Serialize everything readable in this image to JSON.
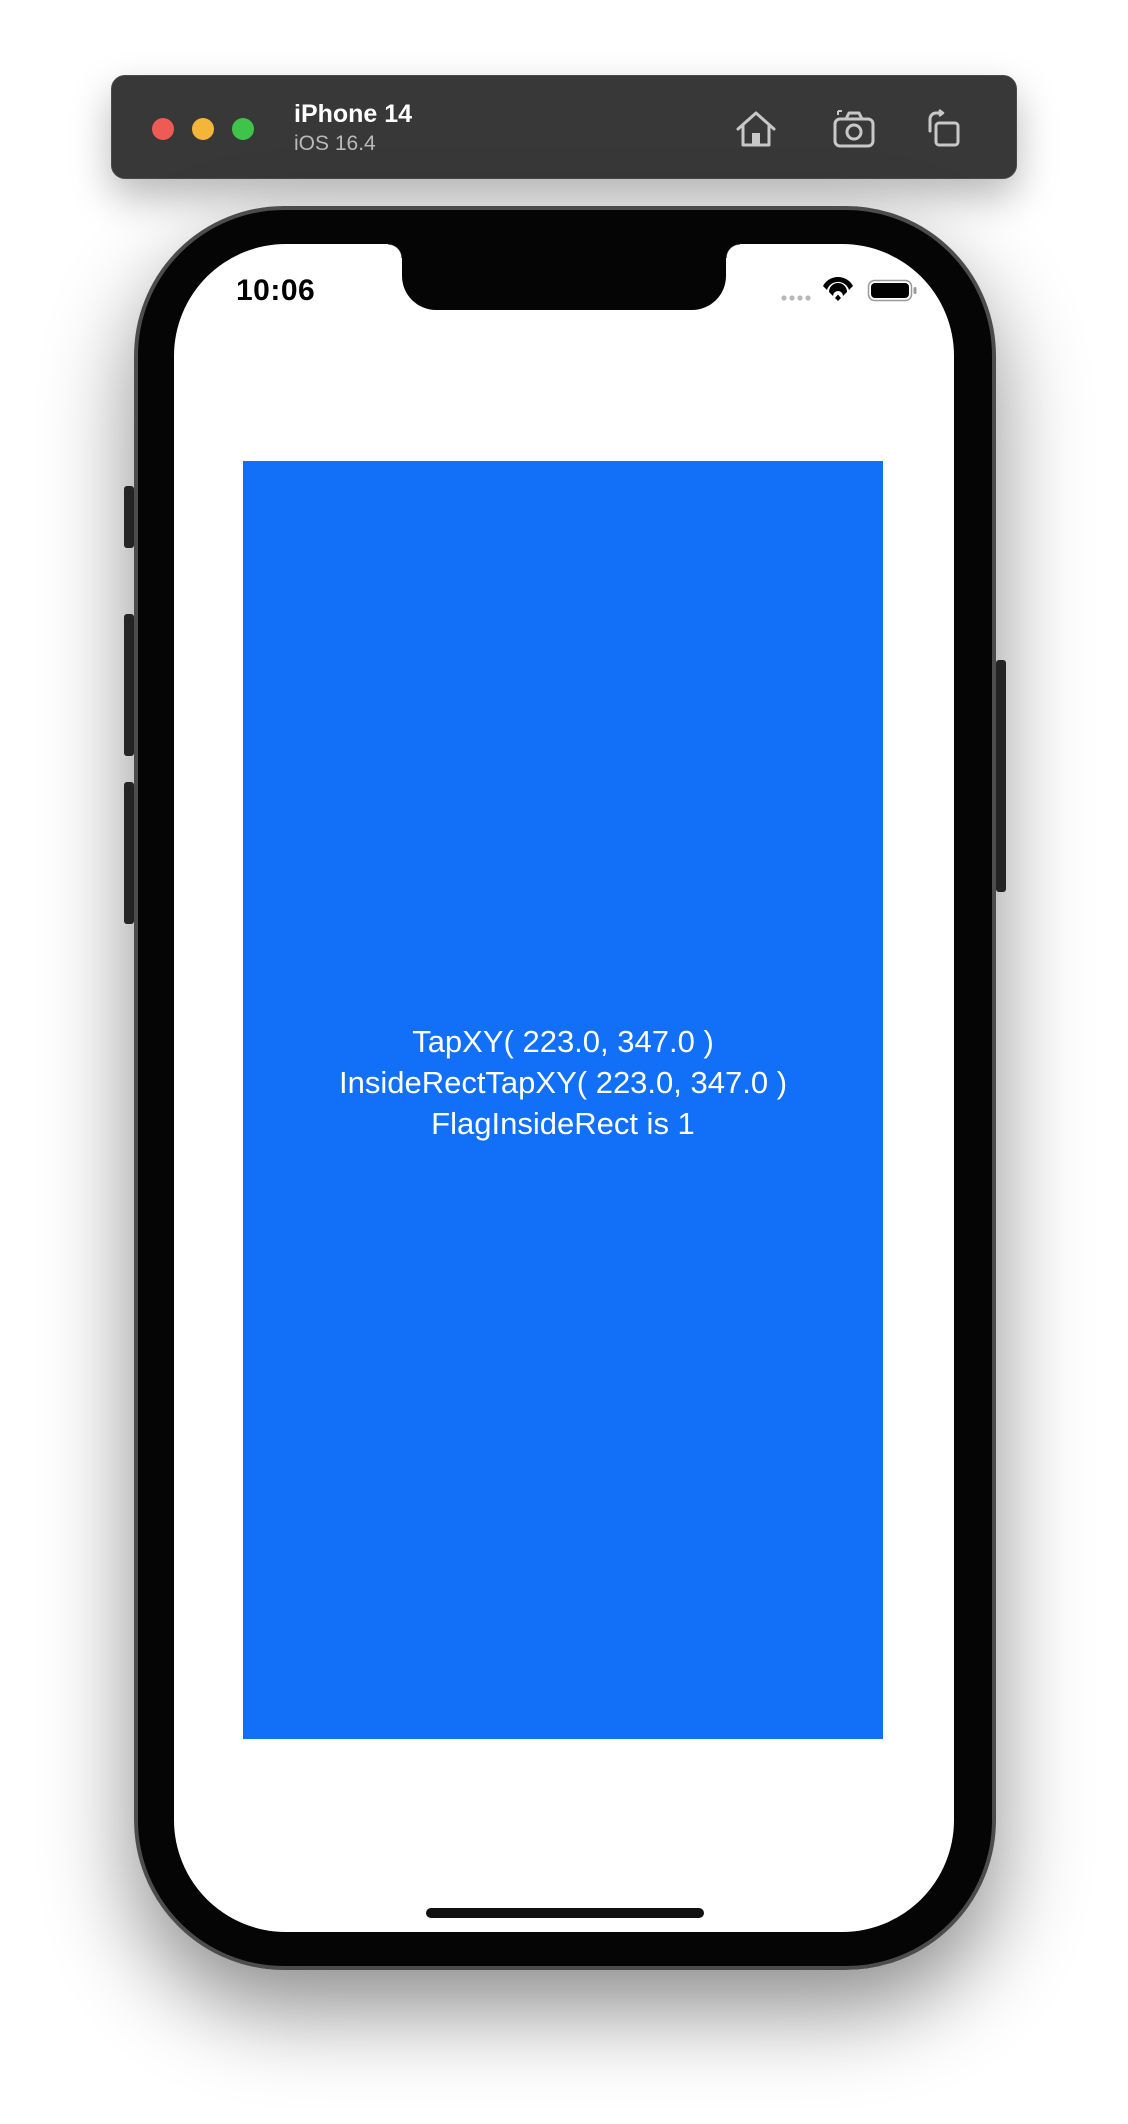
{
  "simulator": {
    "device_name": "iPhone 14",
    "os_version": "iOS 16.4",
    "toolbar_icons": [
      "home-icon",
      "screenshot-icon",
      "rotate-icon"
    ],
    "traffic_lights": {
      "close": "#ee5b55",
      "minimize": "#f4b63a",
      "zoom": "#3fc34b"
    }
  },
  "status_bar": {
    "time": "10:06",
    "icons": [
      "cellular-signal-icon",
      "wifi-icon",
      "battery-icon"
    ]
  },
  "app": {
    "rect_color": "#126ff7",
    "lines": [
      "TapXY( 223.0, 347.0 )",
      "InsideRectTapXY( 223.0, 347.0 )",
      "FlagInsideRect is 1"
    ]
  }
}
